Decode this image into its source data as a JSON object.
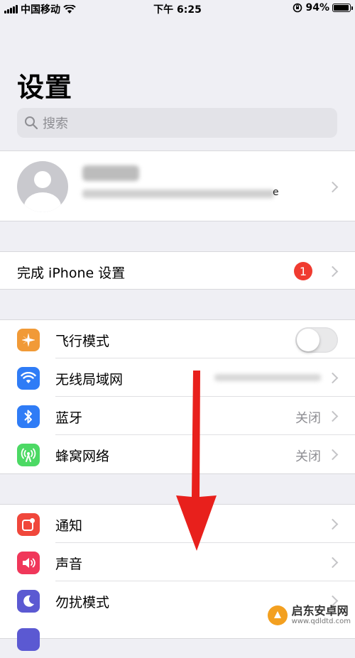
{
  "status_bar": {
    "carrier": "中国移动",
    "time": "下午 6:25",
    "battery_percent": "94%",
    "battery_level": 0.94
  },
  "page": {
    "title": "设置",
    "search_placeholder": "搜索"
  },
  "profile": {
    "subtitle_tail": "e"
  },
  "setup_row": {
    "label": "完成 iPhone 设置",
    "badge": "1"
  },
  "connectivity": [
    {
      "label": "飞行模式",
      "icon": "airplane-icon",
      "color": "#f19a37",
      "toggle": false
    },
    {
      "label": "无线局域网",
      "icon": "wifi-icon",
      "color": "#2f7cf6"
    },
    {
      "label": "蓝牙",
      "icon": "bluetooth-icon",
      "color": "#2f7cf6",
      "value": "关闭"
    },
    {
      "label": "蜂窝网络",
      "icon": "cellular-icon",
      "color": "#4cd964",
      "value": "关闭"
    }
  ],
  "notifications": [
    {
      "label": "通知",
      "icon": "notifications-icon",
      "color": "#f0473b"
    },
    {
      "label": "声音",
      "icon": "sound-icon",
      "color": "#f0375a"
    },
    {
      "label": "勿扰模式",
      "icon": "moon-icon",
      "color": "#5b59d2"
    }
  ],
  "watermark": {
    "name": "启东安卓网",
    "url": "www.qdldtd.com"
  },
  "colors": {
    "background": "#efeff4",
    "arrow": "#e8201c",
    "chevron": "#c4c4c7"
  }
}
